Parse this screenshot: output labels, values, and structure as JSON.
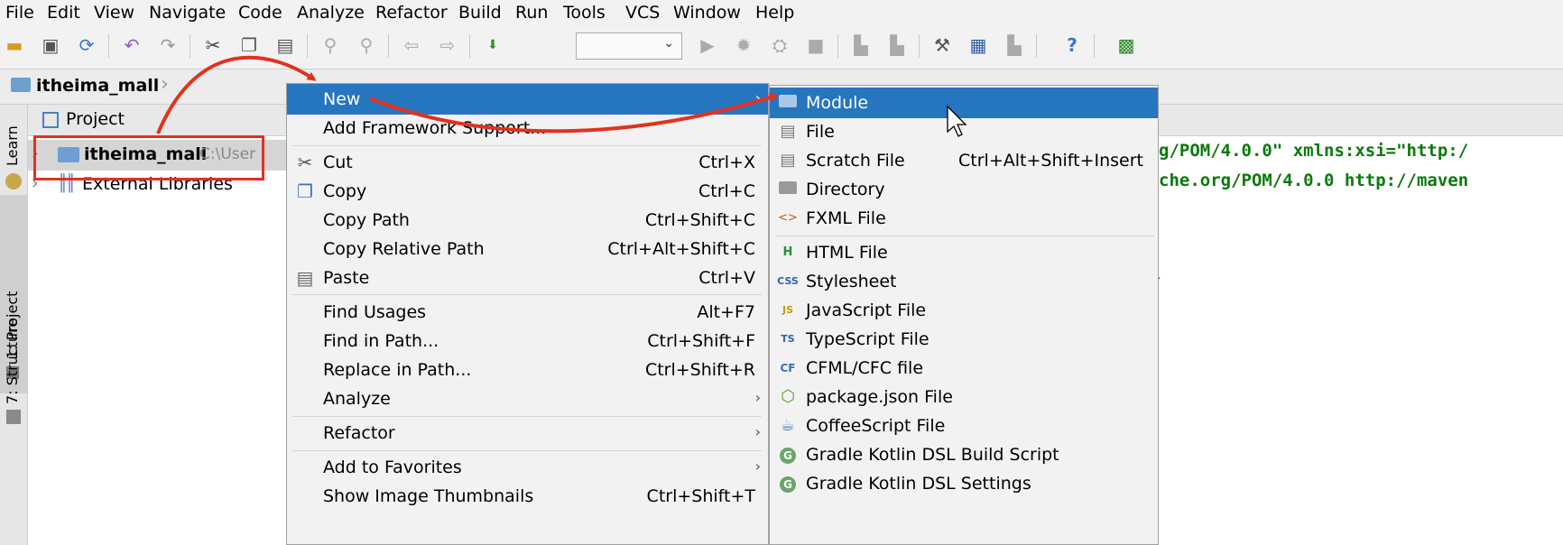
{
  "menubar": [
    "File",
    "Edit",
    "View",
    "Navigate",
    "Code",
    "Analyze",
    "Refactor",
    "Build",
    "Run",
    "Tools",
    "VCS",
    "Window",
    "Help"
  ],
  "breadcrumb": {
    "project": "itheima_mall"
  },
  "side_tabs": {
    "learn": "Learn",
    "project": "1: Project",
    "structure": "7: Structure"
  },
  "project_panel": {
    "header": "Project",
    "root": {
      "name": "itheima_mall",
      "path": "C:\\User"
    },
    "external": "External Libraries"
  },
  "editor": {
    "line1": "g/POM/4.0.0\" xmlns:xsi=\"http:/",
    "line2": "che.org/POM/4.0.0 http://maven"
  },
  "context_menu": {
    "items": [
      {
        "label": "New",
        "shortcut": "",
        "submenu": true
      },
      {
        "label": "Add Framework Support...",
        "shortcut": ""
      },
      {
        "label": "Cut",
        "shortcut": "Ctrl+X",
        "icon": "scissors-icon"
      },
      {
        "label": "Copy",
        "shortcut": "Ctrl+C",
        "icon": "copy-icon"
      },
      {
        "label": "Copy Path",
        "shortcut": "Ctrl+Shift+C"
      },
      {
        "label": "Copy Relative Path",
        "shortcut": "Ctrl+Alt+Shift+C"
      },
      {
        "label": "Paste",
        "shortcut": "Ctrl+V",
        "icon": "paste-icon"
      },
      {
        "label": "Find Usages",
        "shortcut": "Alt+F7"
      },
      {
        "label": "Find in Path...",
        "shortcut": "Ctrl+Shift+F"
      },
      {
        "label": "Replace in Path...",
        "shortcut": "Ctrl+Shift+R"
      },
      {
        "label": "Analyze",
        "shortcut": "",
        "submenu": true
      },
      {
        "label": "Refactor",
        "shortcut": "",
        "submenu": true
      },
      {
        "label": "Add to Favorites",
        "shortcut": "",
        "submenu": true
      },
      {
        "label": "Show Image Thumbnails",
        "shortcut": "Ctrl+Shift+T"
      }
    ]
  },
  "new_submenu": {
    "items": [
      {
        "label": "Module",
        "shortcut": ""
      },
      {
        "label": "File",
        "shortcut": ""
      },
      {
        "label": "Scratch File",
        "shortcut": "Ctrl+Alt+Shift+Insert"
      },
      {
        "label": "Directory",
        "shortcut": ""
      },
      {
        "label": "FXML File",
        "shortcut": ""
      },
      {
        "label": "HTML File",
        "shortcut": ""
      },
      {
        "label": "Stylesheet",
        "shortcut": ""
      },
      {
        "label": "JavaScript File",
        "shortcut": ""
      },
      {
        "label": "TypeScript File",
        "shortcut": ""
      },
      {
        "label": "CFML/CFC file",
        "shortcut": ""
      },
      {
        "label": "package.json File",
        "shortcut": ""
      },
      {
        "label": "CoffeeScript File",
        "shortcut": ""
      },
      {
        "label": "Gradle Kotlin DSL Build Script",
        "shortcut": ""
      },
      {
        "label": "Gradle Kotlin DSL Settings",
        "shortcut": ""
      }
    ]
  },
  "colors": {
    "selection": "#2675bf",
    "annotation": "#e3311f",
    "code_green": "#0b7a0b",
    "code_blue": "#1f3bb3"
  }
}
